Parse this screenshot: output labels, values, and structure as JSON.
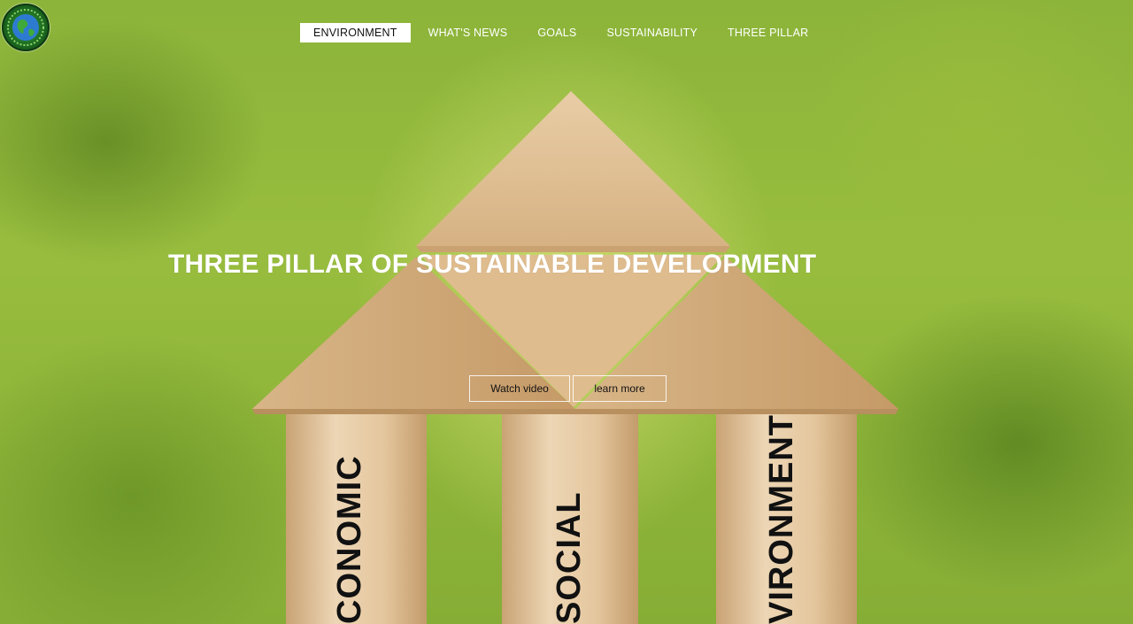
{
  "nav": {
    "items": [
      {
        "label": "ENVIRONMENT",
        "active": true
      },
      {
        "label": "WHAT'S NEWS",
        "active": false
      },
      {
        "label": "GOALS",
        "active": false
      },
      {
        "label": "SUSTAINABILITY",
        "active": false
      },
      {
        "label": "THREE PILLAR",
        "active": false
      }
    ]
  },
  "hero": {
    "title": "THREE PILLAR OF SUSTAINABLE DEVELOPMENT",
    "watch_label": "Watch video",
    "learn_label": "learn more",
    "pillars": [
      "CONOMIC",
      "SOCIAL",
      "VIRONMENT"
    ]
  },
  "colors": {
    "foliage": "#8fb53a",
    "wood": "#e2c195",
    "nav_active_bg": "#ffffff"
  },
  "icons": {
    "logo": "globe-logo-icon"
  }
}
